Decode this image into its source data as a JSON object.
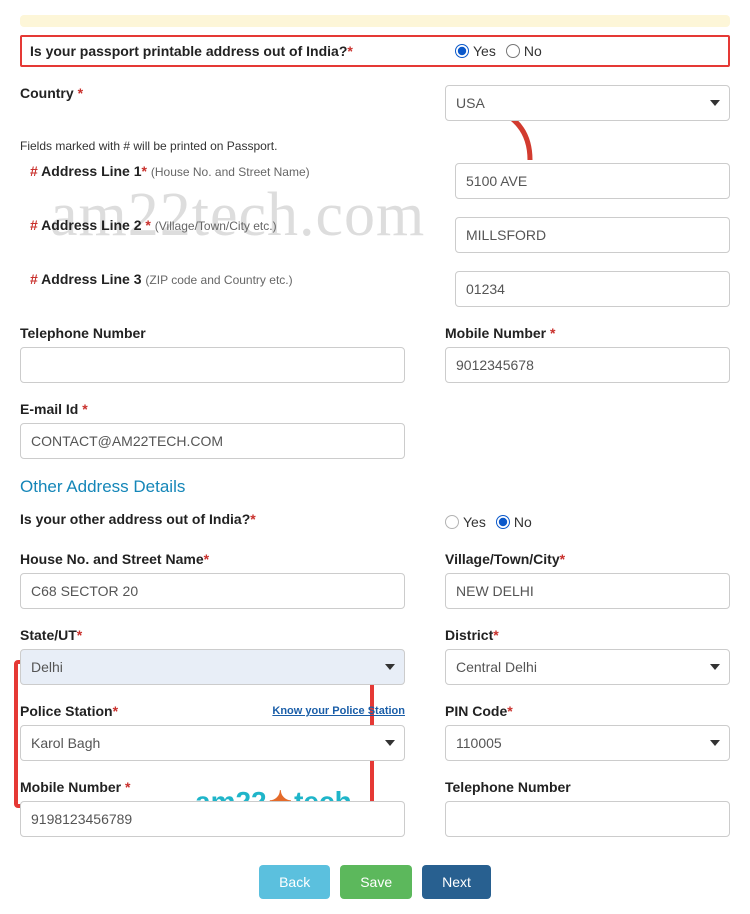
{
  "q1": {
    "label": "Is your passport printable address out of India?",
    "yes": "Yes",
    "no": "No",
    "selected": "yes"
  },
  "country": {
    "label": "Country",
    "value": "USA"
  },
  "fieldsNote": "Fields marked with # will be printed on Passport.",
  "addr1": {
    "label": "Address Line 1",
    "sub": "(House No. and Street Name)",
    "value": "5100 AVE"
  },
  "addr2": {
    "label": "Address Line 2",
    "sub": "(Village/Town/City etc.)",
    "value": "MILLSFORD"
  },
  "addr3": {
    "label": "Address Line 3",
    "sub": "(ZIP code and Country etc.)",
    "value": "01234"
  },
  "tel": {
    "label": "Telephone Number",
    "value": ""
  },
  "mob": {
    "label": "Mobile Number",
    "value": "9012345678"
  },
  "email": {
    "label": "E-mail Id",
    "value": "CONTACT@AM22TECH.COM"
  },
  "section2": "Other Address Details",
  "q2": {
    "label": "Is your other address out of India?",
    "yes": "Yes",
    "no": "No",
    "selected": "no"
  },
  "house": {
    "label": "House No. and Street Name",
    "value": "C68 SECTOR 20"
  },
  "village": {
    "label": "Village/Town/City",
    "value": "NEW DELHI"
  },
  "state": {
    "label": "State/UT",
    "value": "Delhi"
  },
  "district": {
    "label": "District",
    "value": "Central Delhi"
  },
  "police": {
    "label": "Police Station",
    "link": "Know your Police Station",
    "value": "Karol Bagh"
  },
  "pin": {
    "label": "PIN Code",
    "value": "110005"
  },
  "mob2": {
    "label": "Mobile Number",
    "value": "9198123456789"
  },
  "tel2": {
    "label": "Telephone Number",
    "value": ""
  },
  "buttons": {
    "back": "Back",
    "save": "Save",
    "next": "Next"
  },
  "watermark": "am22tech.com",
  "brand": {
    "p1": "am22",
    "p2": "tech"
  }
}
